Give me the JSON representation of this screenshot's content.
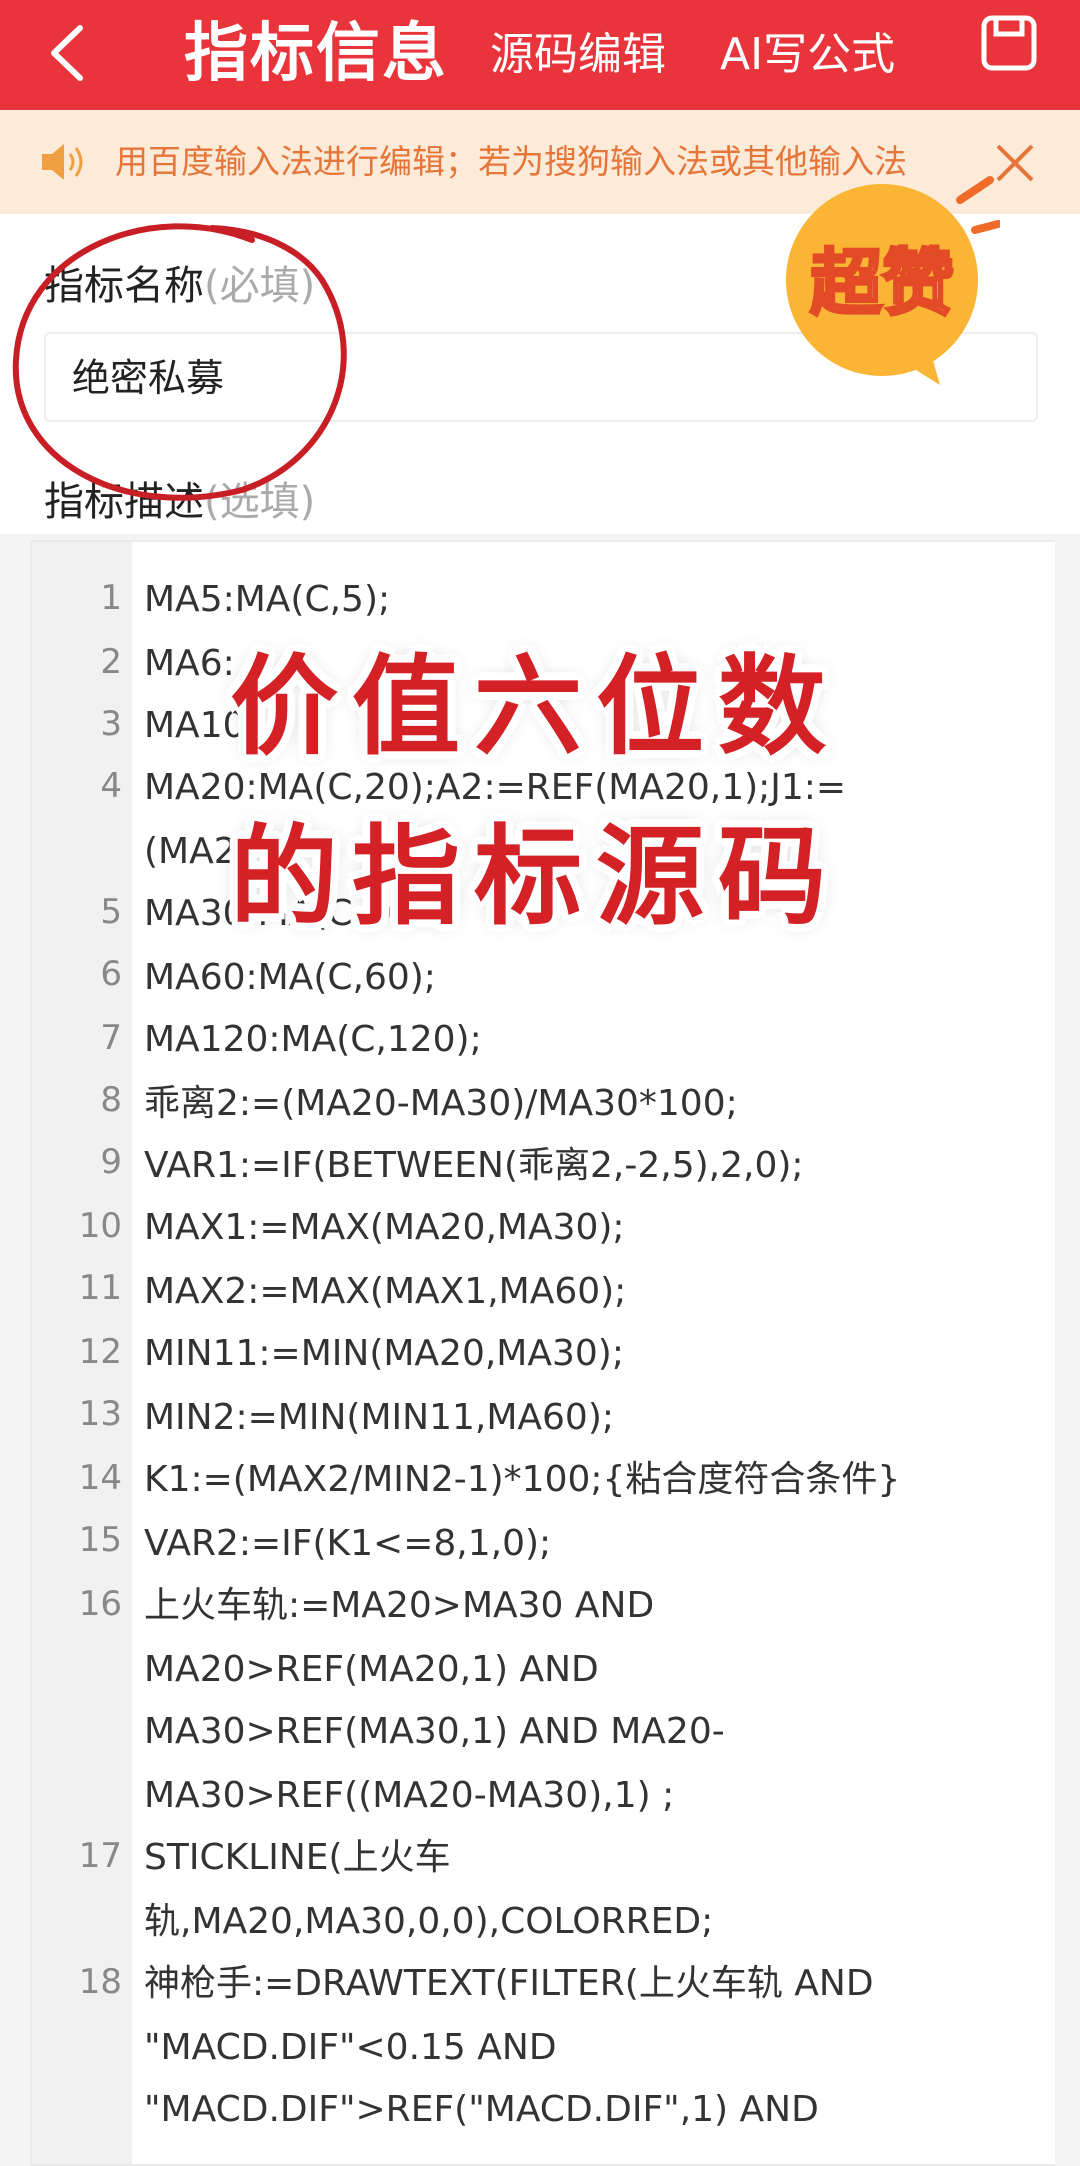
{
  "header": {
    "title": "指标信息",
    "source_edit": "源码编辑",
    "ai_formula": "AI写公式"
  },
  "notice": {
    "text": "用百度输入法进行编辑；若为搜狗输入法或其他输入法"
  },
  "form": {
    "name_label": "指标名称",
    "name_required": "(必填)",
    "name_value": "绝密私募",
    "desc_label": "指标描述",
    "desc_optional": "(选填)"
  },
  "overlay": {
    "badge": "超赞",
    "line1": "价值六位数",
    "line2": "的指标源码"
  },
  "code": {
    "line_numbers": [
      "1",
      "2",
      "3",
      "4",
      "5",
      "6",
      "7",
      "8",
      "9",
      "10",
      "11",
      "12",
      "13",
      "14",
      "15",
      "16",
      "17",
      "18"
    ],
    "lines": [
      "MA5:MA(C,5);",
      "MA6:",
      "MA10",
      "MA20:MA(C,20);A2:=REF(MA20,1);J1:=",
      "(MA2",
      "MA30:MA(C,30",
      "MA60:MA(C,60);",
      "MA120:MA(C,120);",
      "乖离2:=(MA20-MA30)/MA30*100;",
      "VAR1:=IF(BETWEEN(乖离2,-2,5),2,0);",
      "MAX1:=MAX(MA20,MA30);",
      "MAX2:=MAX(MAX1,MA60);",
      "MIN11:=MIN(MA20,MA30);",
      "MIN2:=MIN(MIN11,MA60);",
      "K1:=(MAX2/MIN2-1)*100;{粘合度符合条件}",
      "VAR2:=IF(K1<=8,1,0);",
      "上火车轨:=MA20>MA30 AND",
      "MA20>REF(MA20,1) AND",
      "MA30>REF(MA30,1) AND MA20-",
      "MA30>REF((MA20-MA30),1) ;",
      "STICKLINE(上火车",
      "轨,MA20,MA30,0,0),COLORRED;",
      "神枪手:=DRAWTEXT(FILTER(上火车轨 AND",
      "\"MACD.DIF\"<0.15 AND",
      "\"MACD.DIF\">REF(\"MACD.DIF\",1) AND"
    ]
  }
}
